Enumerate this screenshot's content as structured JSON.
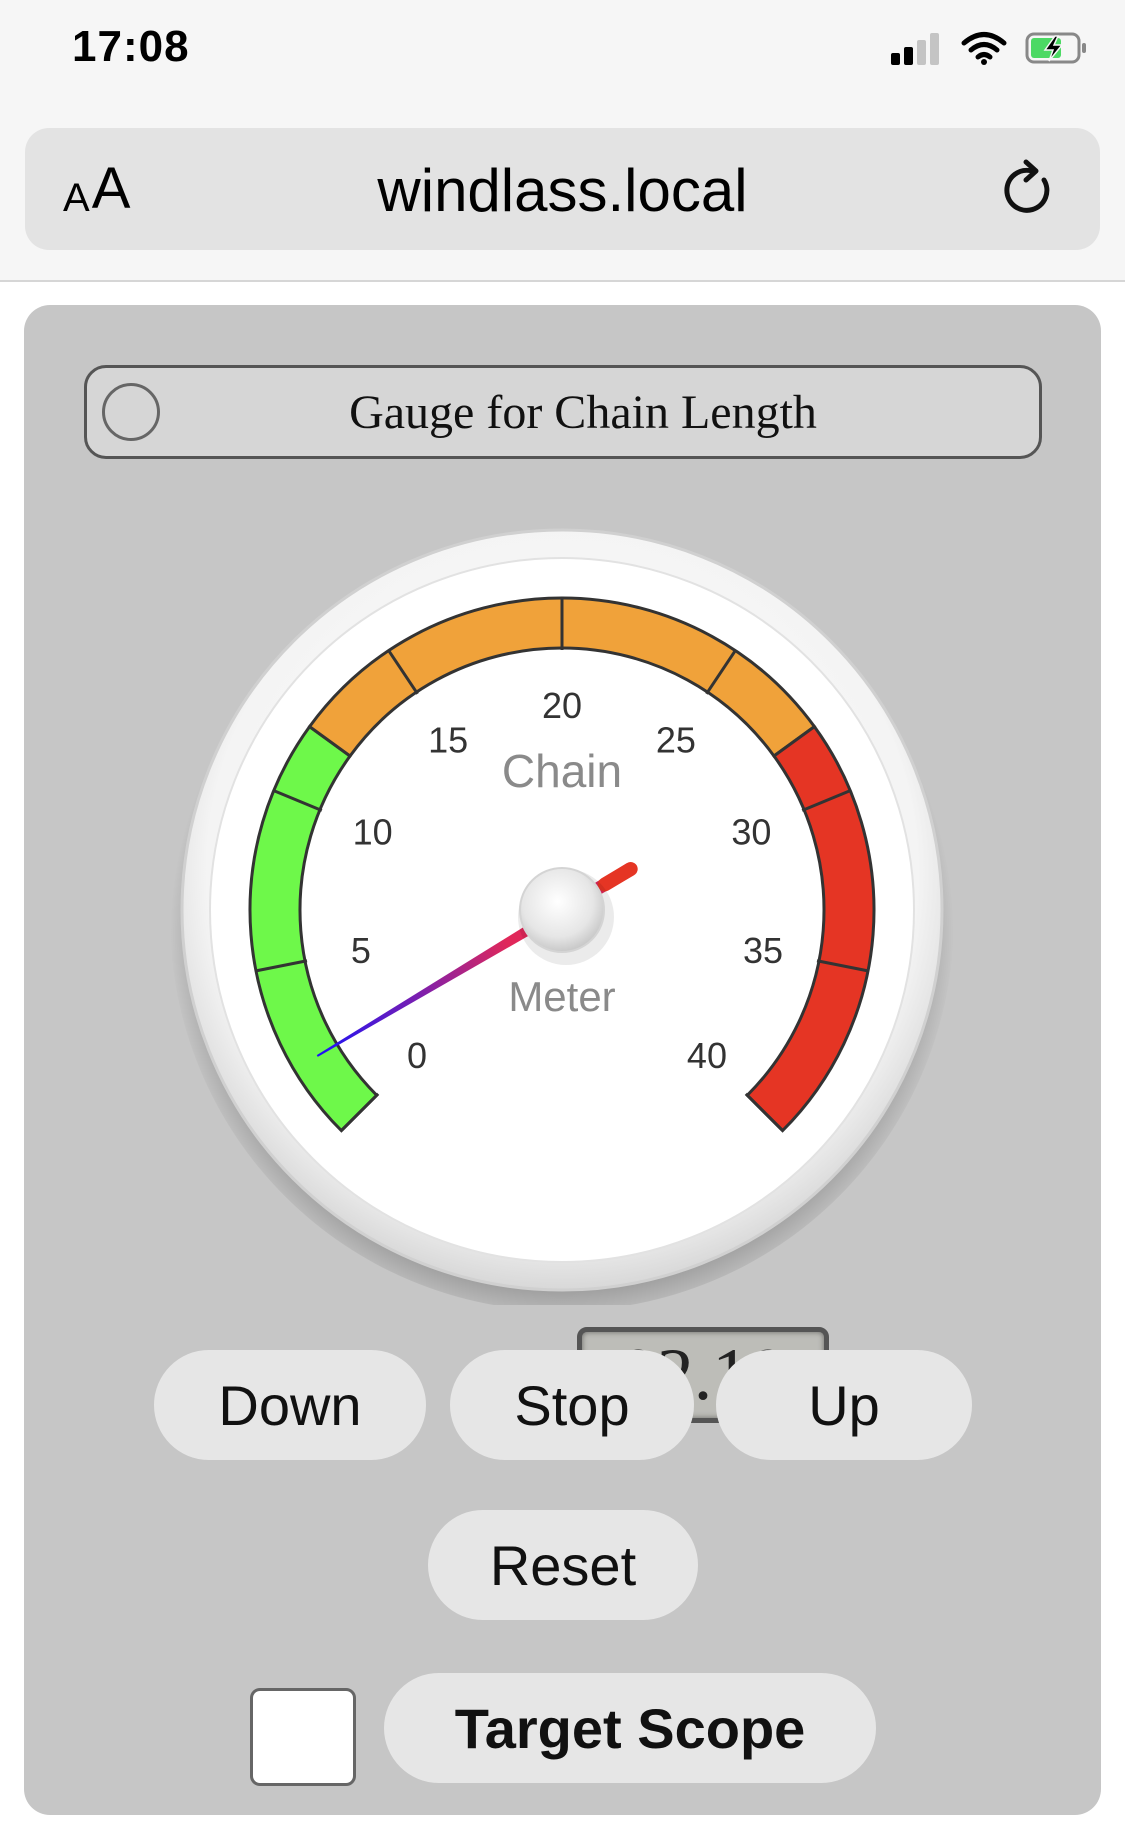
{
  "status_bar": {
    "time": "17:08",
    "icons": [
      "cellular-signal-icon",
      "wifi-icon",
      "battery-charging-icon"
    ]
  },
  "browser": {
    "text_size_button": {
      "small": "A",
      "large": "A"
    },
    "url": "windlass.local",
    "reload_icon": "reload-icon"
  },
  "page": {
    "title": "Gauge for Chain Length",
    "gauge": {
      "label_top": "Chain",
      "label_bottom": "Meter",
      "min": 0,
      "max": 40,
      "value": 2.1,
      "display_value": "02.10",
      "tick_labels": [
        "0",
        "5",
        "10",
        "15",
        "20",
        "25",
        "30",
        "35",
        "40"
      ],
      "zones": [
        {
          "from": 0,
          "to": 12,
          "color": "#6ef84a"
        },
        {
          "from": 12,
          "to": 28,
          "color": "#f0a23a"
        },
        {
          "from": 28,
          "to": 40,
          "color": "#e53524"
        }
      ]
    },
    "buttons": {
      "down": "Down",
      "stop": "Stop",
      "up": "Up",
      "reset": "Reset",
      "target_scope": "Target Scope"
    },
    "target_scope_checked": false
  }
}
